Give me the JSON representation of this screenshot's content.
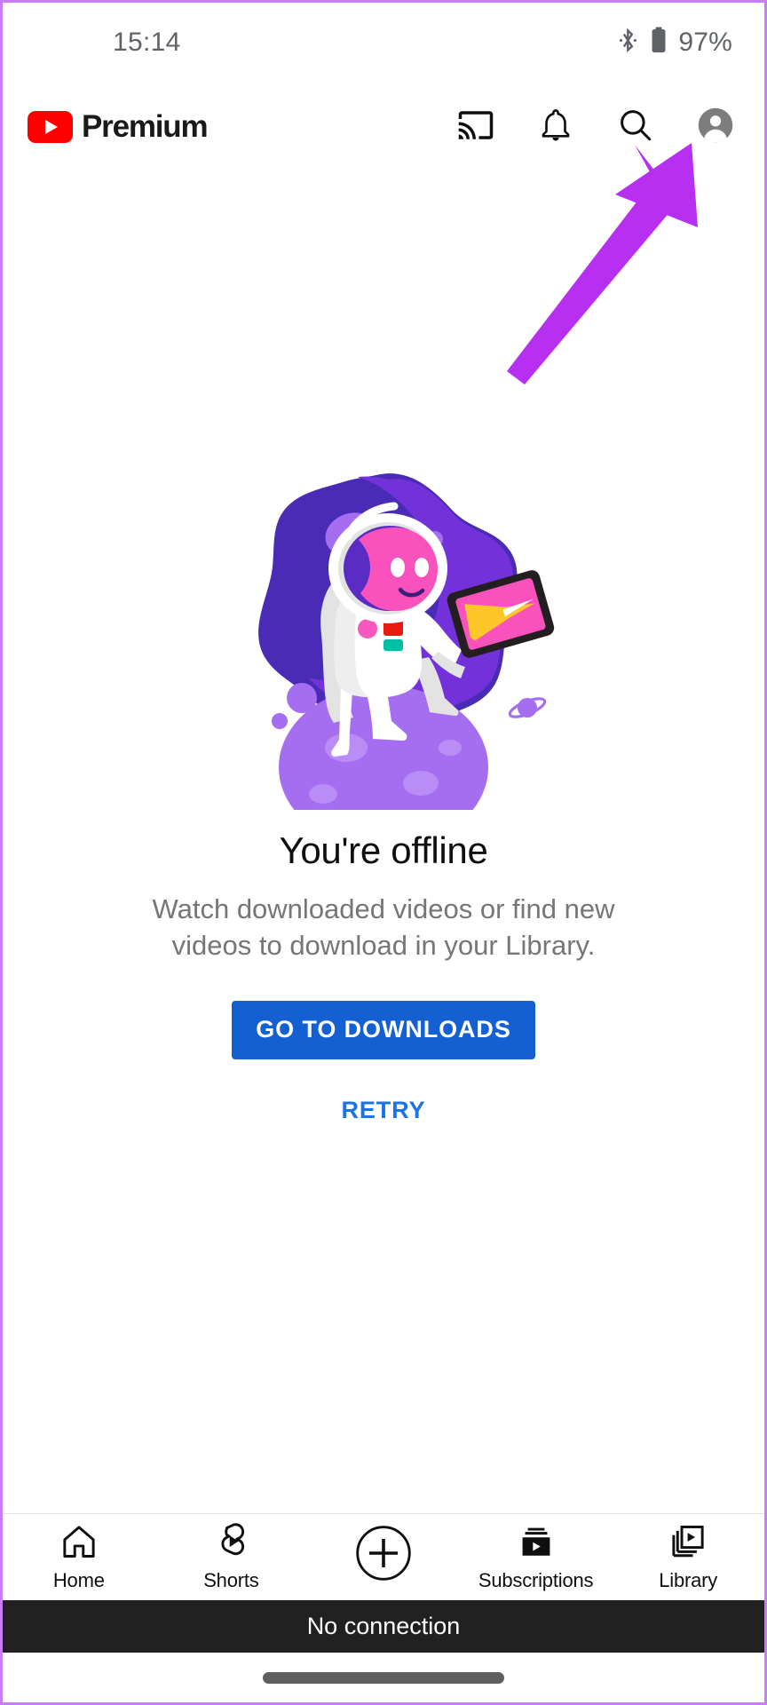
{
  "status_bar": {
    "time": "15:14",
    "battery_percent": "97%",
    "icons": [
      "bluetooth-icon",
      "battery-icon"
    ]
  },
  "app_bar": {
    "brand_word": "Premium",
    "logo_icon": "youtube-logo-icon",
    "actions": [
      {
        "name": "cast-icon",
        "label": "Cast"
      },
      {
        "name": "notifications-bell-icon",
        "label": "Notifications"
      },
      {
        "name": "search-icon",
        "label": "Search"
      },
      {
        "name": "account-avatar-icon",
        "label": "Account"
      }
    ]
  },
  "annotation": {
    "type": "arrow",
    "color": "#b72ff0",
    "points_to": "account-avatar-icon"
  },
  "offline": {
    "illustration": "astronaut-on-planet-illustration",
    "title": "You're offline",
    "subtitle": "Watch downloaded videos or find new videos to download in your Library.",
    "primary_button": "GO TO DOWNLOADS",
    "secondary_button": "RETRY",
    "primary_button_color": "#1460d2",
    "secondary_button_color": "#1a73e8"
  },
  "bottom_nav": {
    "items": [
      {
        "label": "Home",
        "icon": "home-icon"
      },
      {
        "label": "Shorts",
        "icon": "shorts-icon"
      },
      {
        "label": "",
        "icon": "create-plus-icon"
      },
      {
        "label": "Subscriptions",
        "icon": "subscriptions-icon"
      },
      {
        "label": "Library",
        "icon": "library-icon"
      }
    ]
  },
  "toast": {
    "message": "No connection",
    "background": "#212121"
  },
  "home_indicator": {
    "name": "home-indicator"
  }
}
